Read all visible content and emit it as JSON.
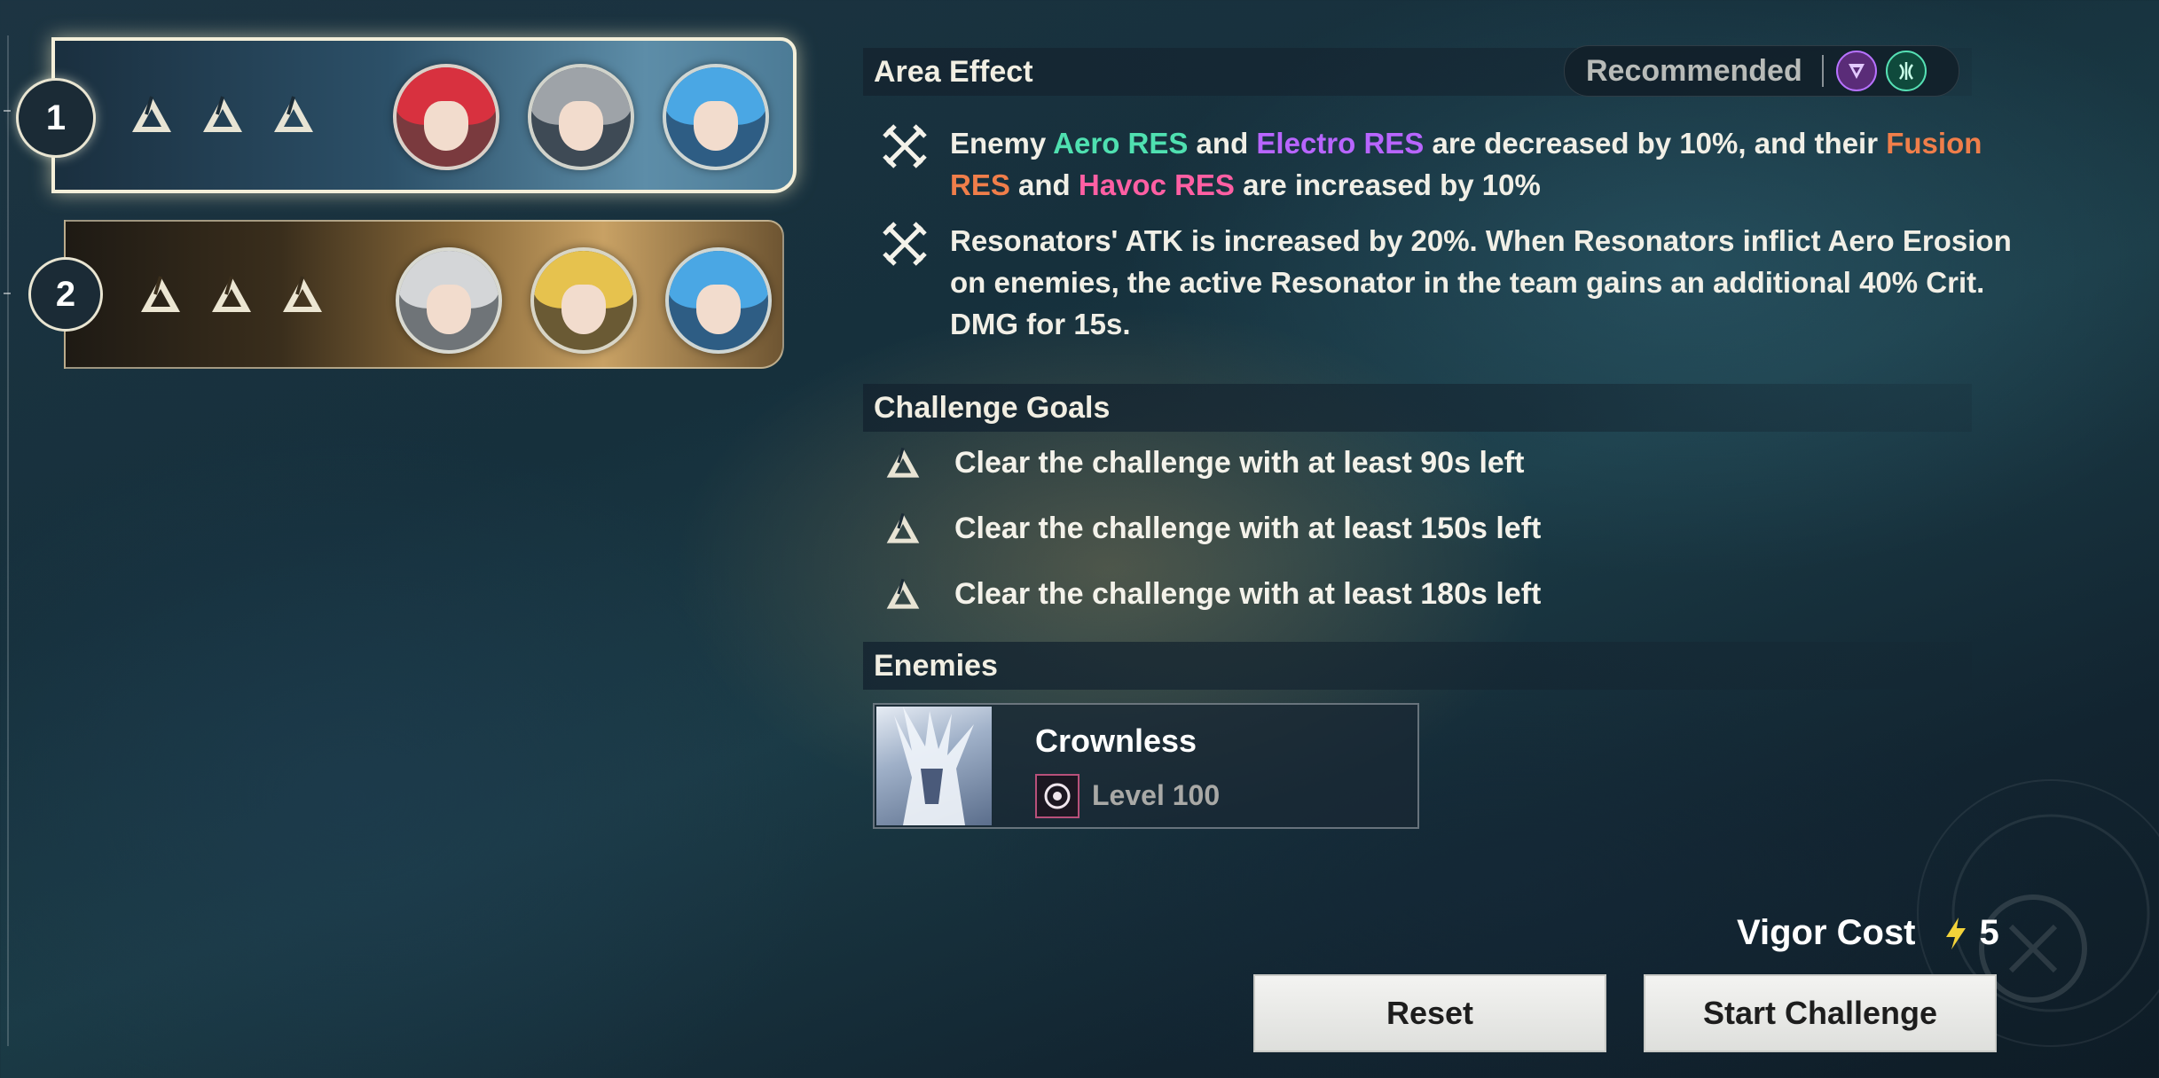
{
  "teams": [
    {
      "number": "1",
      "active": true,
      "stars": 3
    },
    {
      "number": "2",
      "active": false,
      "stars": 3
    }
  ],
  "area_effect": {
    "title": "Area Effect",
    "recommended_label": "Recommended",
    "recommended_elements": [
      "havoc-element-icon",
      "aero-element-icon"
    ],
    "effects": [
      {
        "parts": [
          {
            "text": "Enemy "
          },
          {
            "text": "Aero RES",
            "color": "#4fe0b0"
          },
          {
            "text": " and "
          },
          {
            "text": "Electro RES",
            "color": "#b865ff"
          },
          {
            "text": " are decreased by 10%, and their "
          },
          {
            "text": "Fusion RES",
            "color": "#f07e4a"
          },
          {
            "text": " and "
          },
          {
            "text": "Havoc RES",
            "color": "#ff5fa3"
          },
          {
            "text": " are increased by 10%"
          }
        ]
      },
      {
        "parts": [
          {
            "text": "Resonators' ATK is increased by 20%. When Resonators inflict Aero Erosion on enemies, the active Resonator in the team gains an additional 40% Crit. DMG for 15s."
          }
        ]
      }
    ]
  },
  "challenge_goals": {
    "title": "Challenge Goals",
    "goals": [
      "Clear the challenge with at least 90s left",
      "Clear the challenge with at least 150s left",
      "Clear the challenge with at least 180s left"
    ]
  },
  "enemies": {
    "title": "Enemies",
    "list": [
      {
        "name": "Crownless",
        "level": "Level 100"
      }
    ]
  },
  "vigor": {
    "label": "Vigor Cost",
    "value": "5"
  },
  "buttons": {
    "reset": "Reset",
    "start": "Start Challenge"
  }
}
